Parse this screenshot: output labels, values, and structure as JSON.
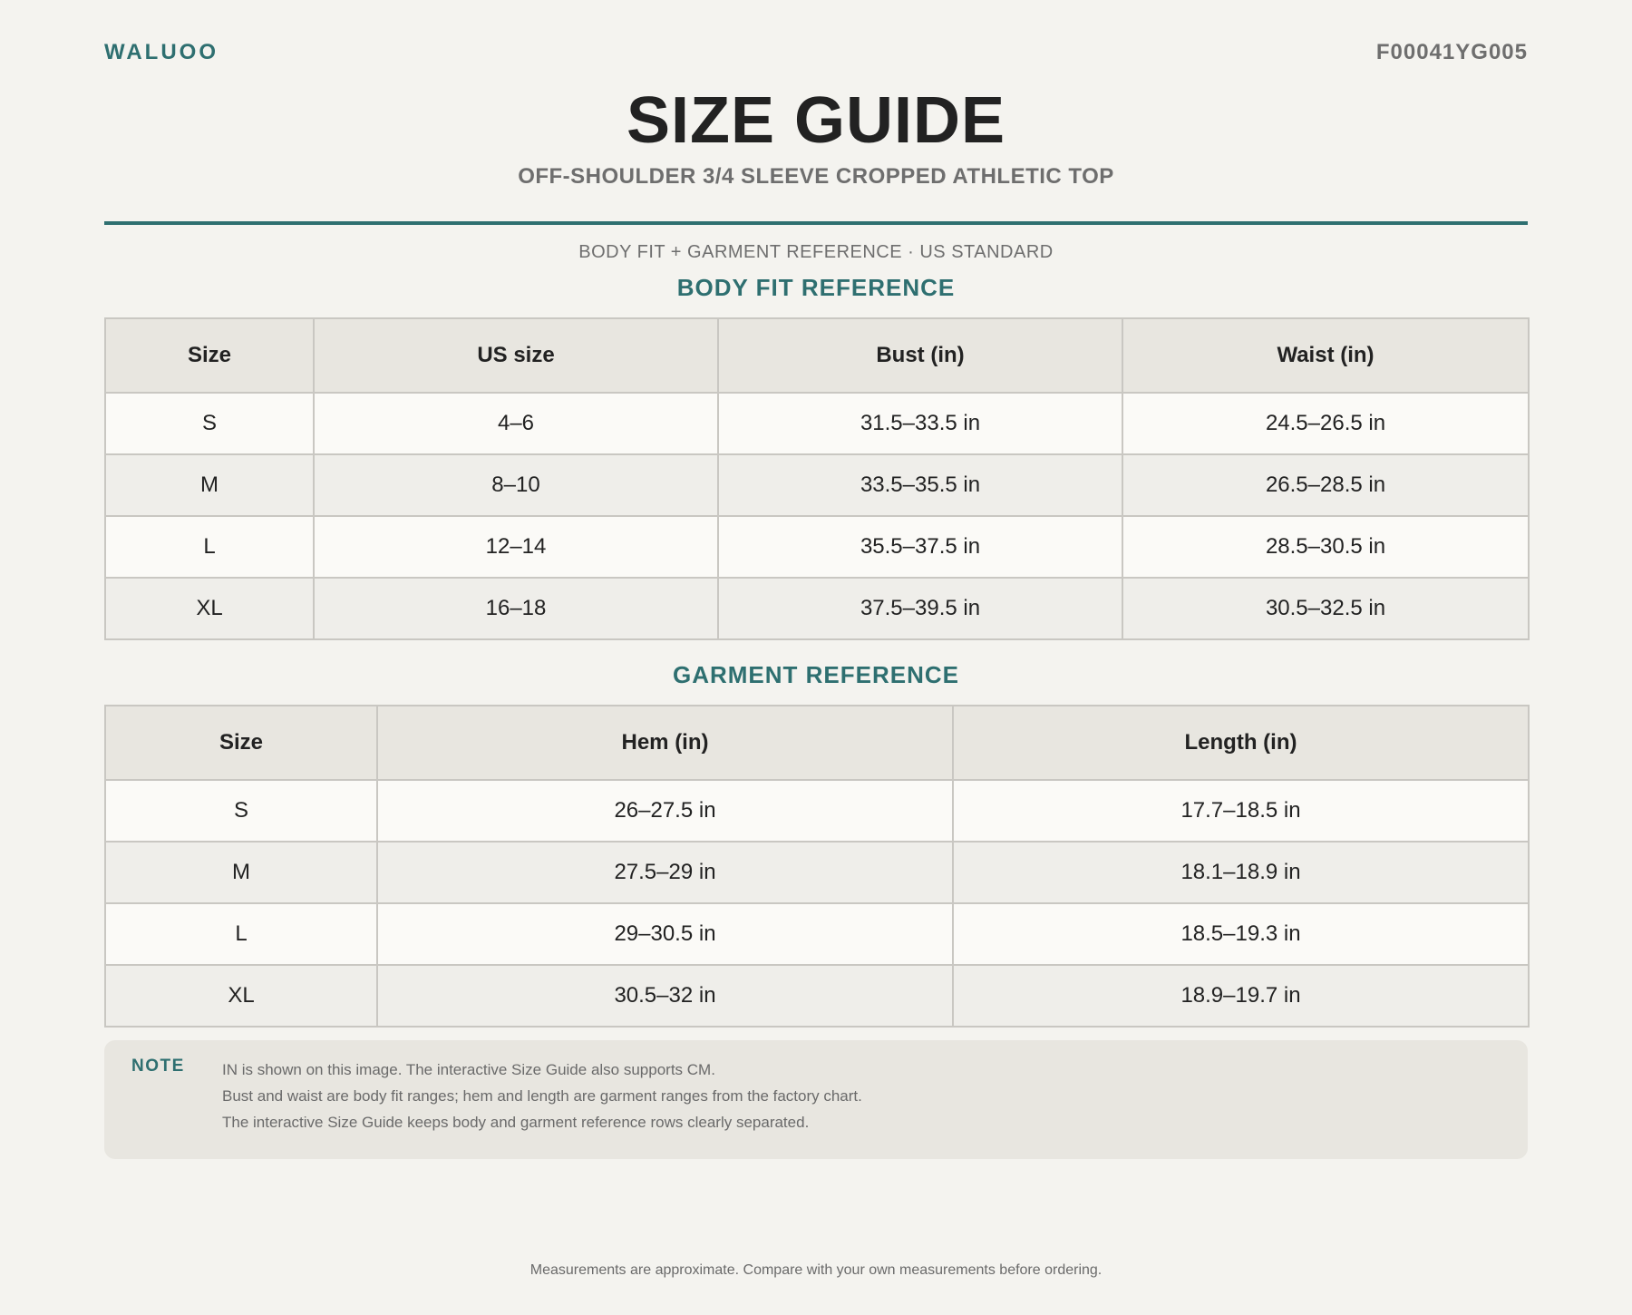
{
  "header": {
    "brand": "WALUOO",
    "code": "F00041YG005",
    "title": "SIZE GUIDE",
    "subtitle": "OFF-SHOULDER 3/4 SLEEVE CROPPED ATHLETIC TOP",
    "caption": "BODY FIT + GARMENT REFERENCE · US STANDARD"
  },
  "colors": {
    "accent": "#2e6f70",
    "background": "#f4f3ef",
    "header_cell": "#e8e6e0"
  },
  "body_fit": {
    "title": "BODY FIT REFERENCE",
    "columns": [
      "Size",
      "US size",
      "Bust (in)",
      "Waist (in)"
    ],
    "rows": [
      [
        "S",
        "4–6",
        "31.5–33.5 in",
        "24.5–26.5 in"
      ],
      [
        "M",
        "8–10",
        "33.5–35.5 in",
        "26.5–28.5 in"
      ],
      [
        "L",
        "12–14",
        "35.5–37.5 in",
        "28.5–30.5 in"
      ],
      [
        "XL",
        "16–18",
        "37.5–39.5 in",
        "30.5–32.5 in"
      ]
    ]
  },
  "garment": {
    "title": "GARMENT REFERENCE",
    "columns": [
      "Size",
      "Hem (in)",
      "Length (in)"
    ],
    "rows": [
      [
        "S",
        "26–27.5 in",
        "17.7–18.5 in"
      ],
      [
        "M",
        "27.5–29 in",
        "18.1–18.9 in"
      ],
      [
        "L",
        "29–30.5 in",
        "18.5–19.3 in"
      ],
      [
        "XL",
        "30.5–32 in",
        "18.9–19.7 in"
      ]
    ]
  },
  "note": {
    "label": "NOTE",
    "lines": [
      "IN is shown on this image. The interactive Size Guide also supports CM.",
      "Bust and waist are body fit ranges; hem and length are garment ranges from the factory chart.",
      "The interactive Size Guide keeps body and garment reference rows clearly separated."
    ]
  },
  "footer": {
    "text": "Measurements are approximate. Compare with your own measurements before ordering."
  }
}
